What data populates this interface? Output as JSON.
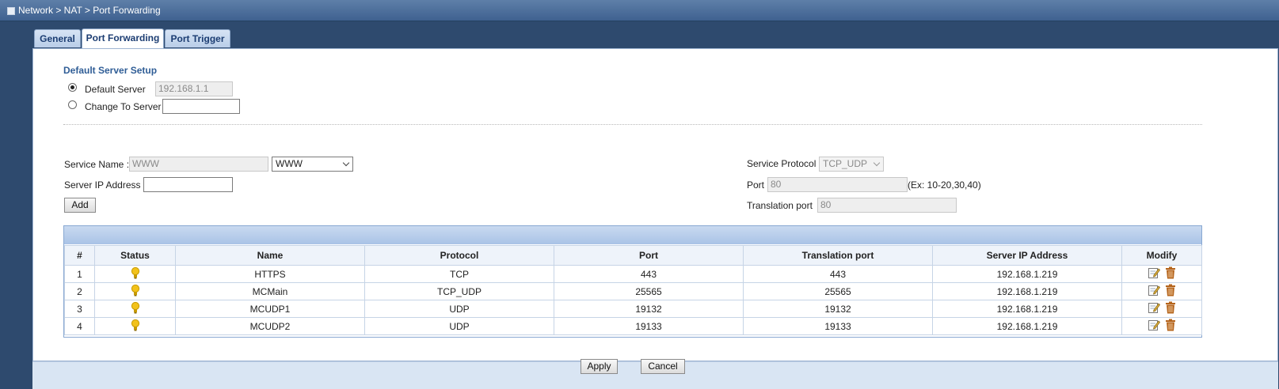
{
  "breadcrumb": "Network > NAT > Port Forwarding",
  "tabs": [
    {
      "label": "General",
      "active": false
    },
    {
      "label": "Port Forwarding",
      "active": true
    },
    {
      "label": "Port Trigger",
      "active": false
    }
  ],
  "default_server": {
    "title": "Default Server Setup",
    "default_label": "Default Server",
    "default_value": "192.168.1.1",
    "change_label": "Change To Server",
    "change_value": "",
    "selected": "default"
  },
  "form": {
    "service_name_label": "Service Name :",
    "service_name_value": "WWW",
    "service_select_value": "WWW",
    "server_ip_label": "Server IP Address",
    "server_ip_value": "",
    "add_label": "Add",
    "service_protocol_label": "Service Protocol",
    "service_protocol_value": "TCP_UDP",
    "port_label": "Port",
    "port_value": "80",
    "port_hint": "(Ex: 10-20,30,40)",
    "translation_port_label": "Translation port",
    "translation_port_value": "80"
  },
  "table": {
    "headers": [
      "#",
      "Status",
      "Name",
      "Protocol",
      "Port",
      "Translation port",
      "Server IP Address",
      "Modify"
    ],
    "rows": [
      {
        "num": "1",
        "status": "on",
        "name": "HTTPS",
        "protocol": "TCP",
        "port": "443",
        "translation_port": "443",
        "server_ip": "192.168.1.219"
      },
      {
        "num": "2",
        "status": "on",
        "name": "MCMain",
        "protocol": "TCP_UDP",
        "port": "25565",
        "translation_port": "25565",
        "server_ip": "192.168.1.219"
      },
      {
        "num": "3",
        "status": "on",
        "name": "MCUDP1",
        "protocol": "UDP",
        "port": "19132",
        "translation_port": "19132",
        "server_ip": "192.168.1.219"
      },
      {
        "num": "4",
        "status": "on",
        "name": "MCUDP2",
        "protocol": "UDP",
        "port": "19133",
        "translation_port": "19133",
        "server_ip": "192.168.1.219"
      }
    ]
  },
  "footer": {
    "apply_label": "Apply",
    "cancel_label": "Cancel"
  },
  "colors": {
    "accent": "#2f5d96",
    "bulb": "#f2c21b",
    "trash": "#b5651d"
  }
}
